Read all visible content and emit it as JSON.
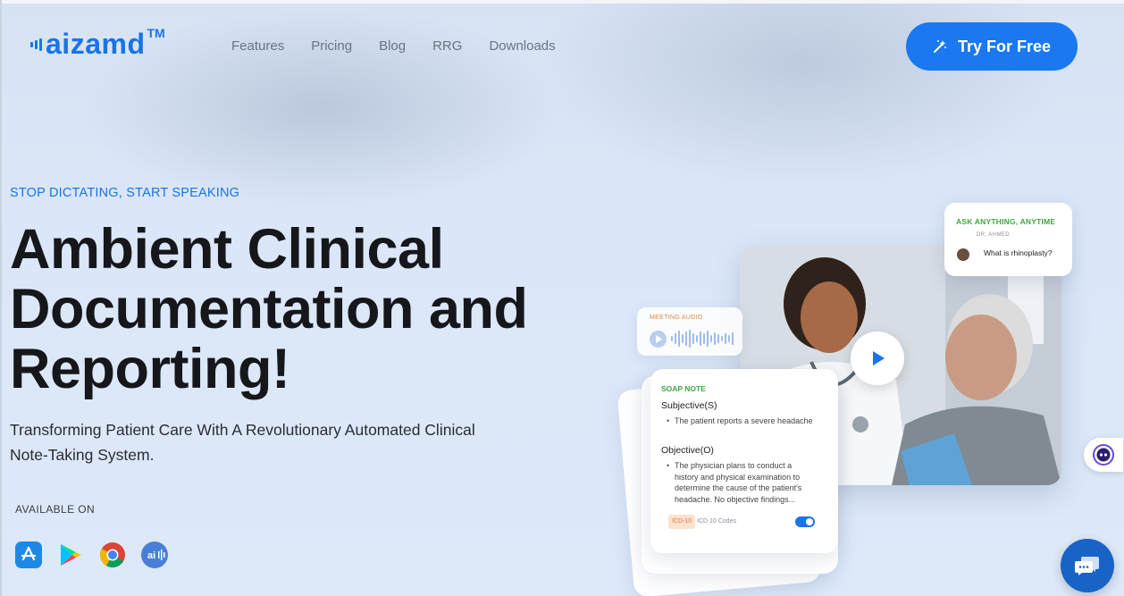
{
  "brand": {
    "name": "aizamd",
    "trademark": "TM",
    "color": "#1a73e8"
  },
  "nav": {
    "items": [
      {
        "label": "Features"
      },
      {
        "label": "Pricing"
      },
      {
        "label": "Blog"
      },
      {
        "label": "RRG"
      },
      {
        "label": "Downloads"
      }
    ]
  },
  "cta": {
    "label": "Try For Free",
    "icon": "magic-wand-icon",
    "color": "#1a78f0"
  },
  "hero": {
    "eyebrow": "STOP DICTATING, START SPEAKING",
    "headline": "Ambient Clinical Documentation and Reporting!",
    "subtext": "Transforming Patient Care With A Revolutionary Automated Clinical Note-Taking System.",
    "available_label": "AVAILABLE ON",
    "platforms": [
      {
        "name": "App Store",
        "icon": "app-store-icon"
      },
      {
        "name": "Google Play",
        "icon": "google-play-icon"
      },
      {
        "name": "Chrome",
        "icon": "chrome-icon"
      },
      {
        "name": "Voice App",
        "icon": "audio-app-icon"
      }
    ]
  },
  "ask_card": {
    "title": "ASK ANYTHING, ANYTIME",
    "doctor": "DR. AHMED",
    "question": "What is rhinoplasty?"
  },
  "audio_card": {
    "label": "MEETING AUDIO"
  },
  "soap_card": {
    "title": "SOAP NOTE",
    "subjective_heading": "Subjective(S)",
    "subjective_text": "The patient reports a severe headache",
    "objective_heading": "Objective(O)",
    "objective_text": "The physician plans to conduct a history and physical examination to determine the cause of the patient's headache. No objective findings...",
    "icd_badge": "ICD-10",
    "icd_label": "ICD 10 Codes",
    "toggle_on": true
  },
  "colors": {
    "accent": "#1a73e8",
    "green": "#3fa63f",
    "orange": "#e07a3a",
    "chat": "#1763c6"
  }
}
